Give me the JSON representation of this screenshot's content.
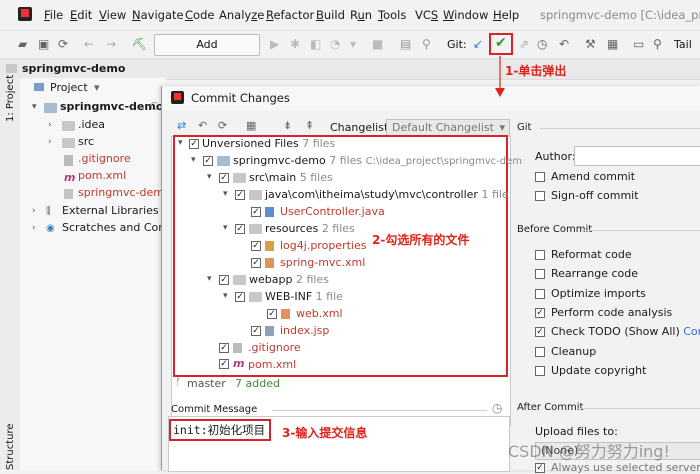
{
  "menubar": {
    "items": [
      "File",
      "Edit",
      "View",
      "Navigate",
      "Code",
      "Analyze",
      "Refactor",
      "Build",
      "Run",
      "Tools",
      "VCS",
      "Window",
      "Help"
    ],
    "underlined": [
      "F",
      "E",
      "V",
      "N",
      "C",
      "z",
      "R",
      "B",
      "u",
      "T",
      "S",
      "W",
      "H"
    ],
    "title": "springmvc-demo [C:\\idea_project"
  },
  "toolbar": {
    "add_config": "Add Configuration...",
    "git_label": "Git:",
    "tail": "Tail"
  },
  "projbar": {
    "project_name": "springmvc-demo"
  },
  "leftstrip": {
    "project_tab": "1: Project",
    "structure_tab": "Structure"
  },
  "project_panel": {
    "header": "Project",
    "root": "springmvc-demo",
    "root_suffix": "C",
    "items": [
      ".idea",
      "src",
      ".gitignore",
      "pom.xml",
      "springmvc-demo.",
      "External Libraries",
      "Scratches and Conso"
    ]
  },
  "dialog": {
    "title": "Commit Changes",
    "changelist_label": "Changelist:",
    "changelist_value": "Default Changelist",
    "git_section": "Git",
    "tree": {
      "unversioned": "Unversioned Files",
      "unversioned_count": "7 files",
      "module": "springmvc-demo",
      "module_count": "7 files",
      "module_path": "C:\\idea_project\\springmvc-dem",
      "srcmain": "src\\main",
      "srcmain_count": "5 files",
      "java_pkg": "java\\com\\itheima\\study\\mvc\\controller",
      "java_pkg_count": "1 file",
      "controller": "UserController.java",
      "resources": "resources",
      "resources_count": "2 files",
      "log4j": "log4j.properties",
      "springmvc": "spring-mvc.xml",
      "webapp": "webapp",
      "webapp_count": "2 files",
      "webinf": "WEB-INF",
      "webinf_count": "1 file",
      "webxml": "web.xml",
      "indexjsp": "index.jsp",
      "gitignore": ".gitignore",
      "pomxml": "pom.xml"
    },
    "status": {
      "branch": "master",
      "added": "7 added"
    },
    "commit_message_label": "Commit Message",
    "commit_message": "init:初始化项目",
    "right": {
      "author_label": "Author:",
      "amend": "Amend commit",
      "signoff": "Sign-off commit",
      "before_commit": "Before Commit",
      "reformat": "Reformat code",
      "rearrange": "Rearrange code",
      "optimize": "Optimize imports",
      "analysis": "Perform code analysis",
      "todo": "Check TODO (Show All)",
      "todo_link": "Configu",
      "cleanup": "Cleanup",
      "copyright": "Update copyright",
      "after_commit": "After Commit",
      "upload": "Upload files to:",
      "upload_value": "(None)",
      "always": "Always use selected server or gr"
    }
  },
  "annotations": {
    "a1": "1-单击弹出",
    "a2": "2-勾选所有的文件",
    "a3": "3-输入提交信息",
    "watermark": "CSDN @努力努力ing!"
  }
}
